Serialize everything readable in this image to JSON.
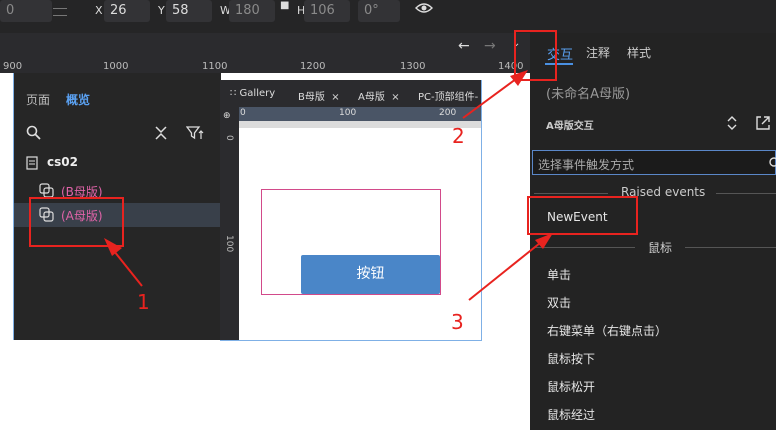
{
  "toolbar": {
    "rotate_partial": "0",
    "x_label": "X",
    "x_value": "26",
    "y_label": "Y",
    "y_value": "58",
    "w_label": "W",
    "w_value": "180",
    "h_label": "H",
    "h_value": "106",
    "angle_value": "0°"
  },
  "ruler_top": [
    "900",
    "1000",
    "1100",
    "1200",
    "1300",
    "1400"
  ],
  "overview": {
    "tab_pages": "页面",
    "tab_outline": "概览",
    "page_name": "cs02",
    "items": [
      {
        "label": "(B母版)"
      },
      {
        "label": "(A母版)"
      }
    ]
  },
  "preview": {
    "tabs": [
      "Gallery",
      "B母版",
      "A母版",
      "PC-顶部组件-"
    ],
    "ruler_h": [
      "0",
      "100",
      "200"
    ],
    "ruler_v": [
      "0",
      "100"
    ],
    "button_label": "按钮"
  },
  "right_panel": {
    "tabs": [
      "交互",
      "注释",
      "样式"
    ],
    "title": "(未命名A母版)",
    "section": "A母版交互",
    "search_placeholder": "选择事件触发方式",
    "group1": "Raised events",
    "event_new": "NewEvent",
    "group2": "鼠标",
    "events": [
      "单击",
      "双击",
      "右键菜单（右键点击）",
      "鼠标按下",
      "鼠标松开",
      "鼠标经过"
    ]
  },
  "annotations": [
    "1",
    "2",
    "3"
  ],
  "colors": {
    "accent": "#4a90e2",
    "annotation": "#e8231f",
    "master_label": "#e063a8"
  }
}
